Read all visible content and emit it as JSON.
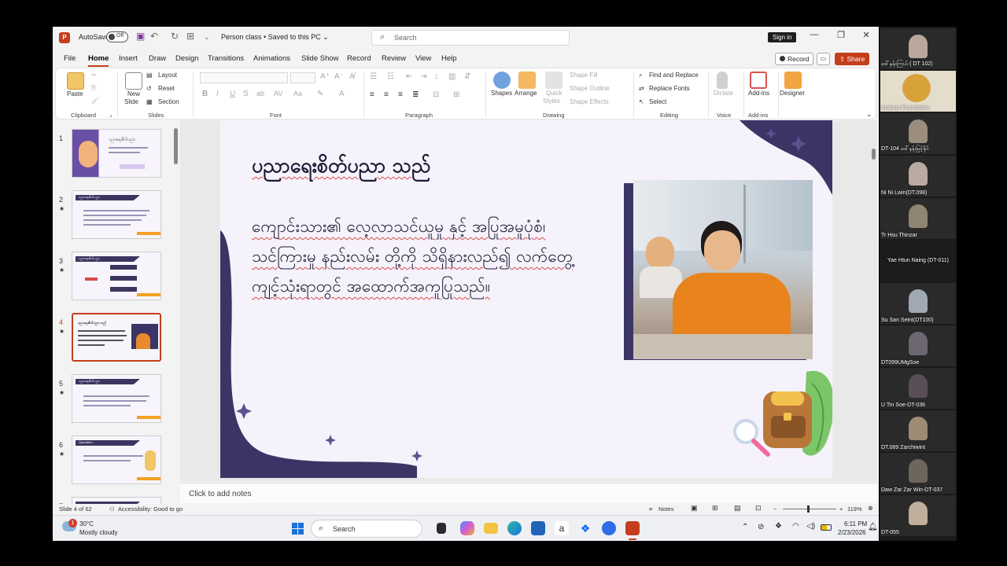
{
  "titlebar": {
    "autosave_label": "AutoSave",
    "autosave_state": "Off",
    "doc_title": "Person class • Saved to this PC ⌄",
    "search_placeholder": "Search",
    "signin_label": "Sign in"
  },
  "menu_tabs": [
    "File",
    "Home",
    "Insert",
    "Draw",
    "Design",
    "Transitions",
    "Animations",
    "Slide Show",
    "Record",
    "Review",
    "View",
    "Help"
  ],
  "menu_actions": {
    "record": "Record",
    "share": "Share"
  },
  "ribbon": {
    "clipboard": {
      "paste": "Paste",
      "group": "Clipboard"
    },
    "slides": {
      "new_slide": "New",
      "new_slide2": "Slide",
      "layout": "Layout",
      "reset": "Reset",
      "section": "Section",
      "group": "Slides"
    },
    "font": {
      "group": "Font"
    },
    "paragraph": {
      "group": "Paragraph"
    },
    "drawing": {
      "shapes": "Shapes",
      "arrange": "Arrange",
      "quick_styles": "Quick",
      "quick_styles2": "Styles",
      "shape_fill": "Shape Fill",
      "shape_outline": "Shape Outline",
      "shape_effects": "Shape Effects",
      "group": "Drawing"
    },
    "editing": {
      "find_replace": "Find and Replace",
      "replace_fonts": "Replace Fonts",
      "select": "Select",
      "group": "Editing"
    },
    "voice": {
      "dictate": "Dictate",
      "group": "Voice"
    },
    "addins": {
      "addins": "Add-ins",
      "group": "Add-ins"
    },
    "designer": {
      "designer": "Designer"
    }
  },
  "thumbnails": [
    {
      "num": "1",
      "star": "",
      "title": "ပညာရေးစိတ်ပညာ"
    },
    {
      "num": "2",
      "star": "★",
      "title": "ပညာရေးစိတ်ပညာ"
    },
    {
      "num": "3",
      "star": "★",
      "title": "ပညာရေးစိတ်ပညာ"
    },
    {
      "num": "4",
      "star": "★",
      "title": "ပညာရေးစိတ်ပညာ သည်"
    },
    {
      "num": "5",
      "star": "★",
      "title": "ပညာရေးစိတ်ပညာ"
    },
    {
      "num": "6",
      "star": "★",
      "title": "Operation"
    },
    {
      "num": "7",
      "star": "",
      "title": ""
    }
  ],
  "slide": {
    "title": "ပညာရေးစိတ်ပညာ သည်",
    "body": "ကျောင်းသား၏ လေ့လာသင်ယူမှု နှင့် အပြုအမူပုံစံ၊ သင်ကြားမှု နည်းလမ်း တို့ကို သိရှိနားလည်၍ လက်တွေ့ကျင့်သုံးရာတွင် အထောက်အကူပြုသည်။"
  },
  "notes_placeholder": "Click to add notes",
  "status": {
    "slide_counter": "Slide 4 of 62",
    "accessibility": "Accessibility: Good to go",
    "notes_btn": "Notes",
    "zoom": "119%"
  },
  "taskbar": {
    "weather_temp": "30°C",
    "weather_desc": "Mostly cloudy",
    "weather_badge": "1",
    "search_label": "Search",
    "time": "6:11 PM",
    "date": "2/23/2026"
  },
  "participants": [
    {
      "name": "ဒေါ်နန်းကြယ် ( DT 102)",
      "video": true,
      "color": "#b8a79a"
    },
    {
      "name": "Araham Foundation",
      "video": true,
      "color": "#d8a23a"
    },
    {
      "name": "DT-104 ဒေါ်နန်းမြင့်နိုင်",
      "video": true,
      "color": "#9b8e7f"
    },
    {
      "name": "Ni Ni Lwin(DT.098)",
      "video": true,
      "color": "#b9aaa2"
    },
    {
      "name": "Tr Hsu Thinzar",
      "video": true,
      "color": "#8f8572"
    },
    {
      "name": "Yae Htun Naing (DT-011)",
      "video": false,
      "color": "#1c1c1c"
    },
    {
      "name": "Su San Seint(DT100)",
      "video": true,
      "color": "#a0a8b4"
    },
    {
      "name": "DT099UMgSoe",
      "video": true,
      "color": "#6d6772"
    },
    {
      "name": "U Tin Soe-DT-036",
      "video": true,
      "color": "#5a4f57"
    },
    {
      "name": "DT.089 Zarchiwint",
      "video": true,
      "color": "#9e8b73"
    },
    {
      "name": "Daw Zar Zar Win-DT-037",
      "video": true,
      "color": "#6e665c"
    },
    {
      "name": "DT-055",
      "video": true,
      "color": "#bfae9b"
    }
  ],
  "colors": {
    "accent": "#c43e1c",
    "slide_purple": "#3b3566",
    "slide_bg": "#f6f2fb"
  }
}
